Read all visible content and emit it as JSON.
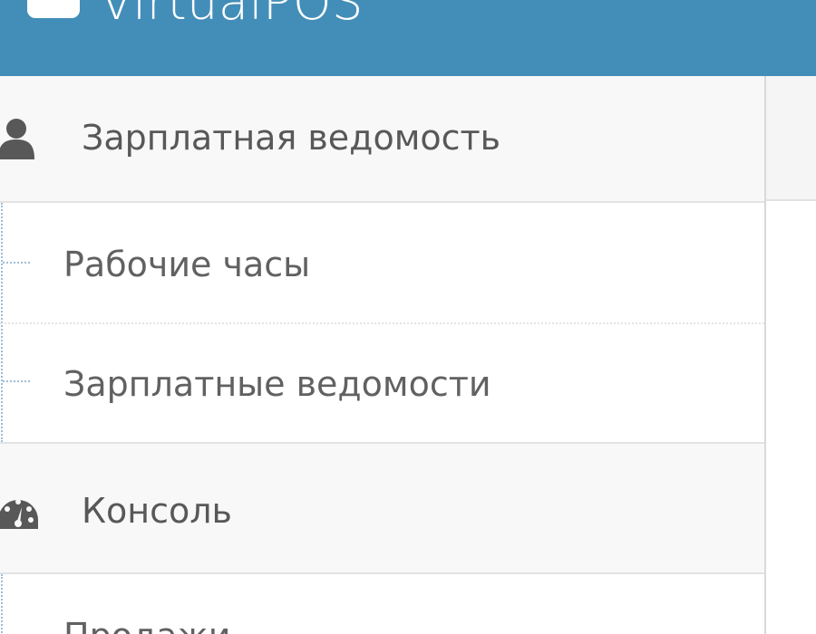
{
  "app": {
    "brand_name": "VirtualPOS",
    "brand_icon": "briefcase-icon"
  },
  "sidebar": {
    "items": [
      {
        "label": "Зарплатная ведомость",
        "icon": "user-icon",
        "submenu": [
          {
            "label": "Рабочие часы"
          },
          {
            "label": "Зарплатные ведомости"
          }
        ]
      },
      {
        "label": "Консоль",
        "icon": "dashboard-icon",
        "submenu": [
          {
            "label": "Продажи"
          }
        ]
      }
    ]
  },
  "colors": {
    "header_bg": "#438eb9",
    "nav_bg": "#f8f8f8",
    "text": "#585858"
  }
}
